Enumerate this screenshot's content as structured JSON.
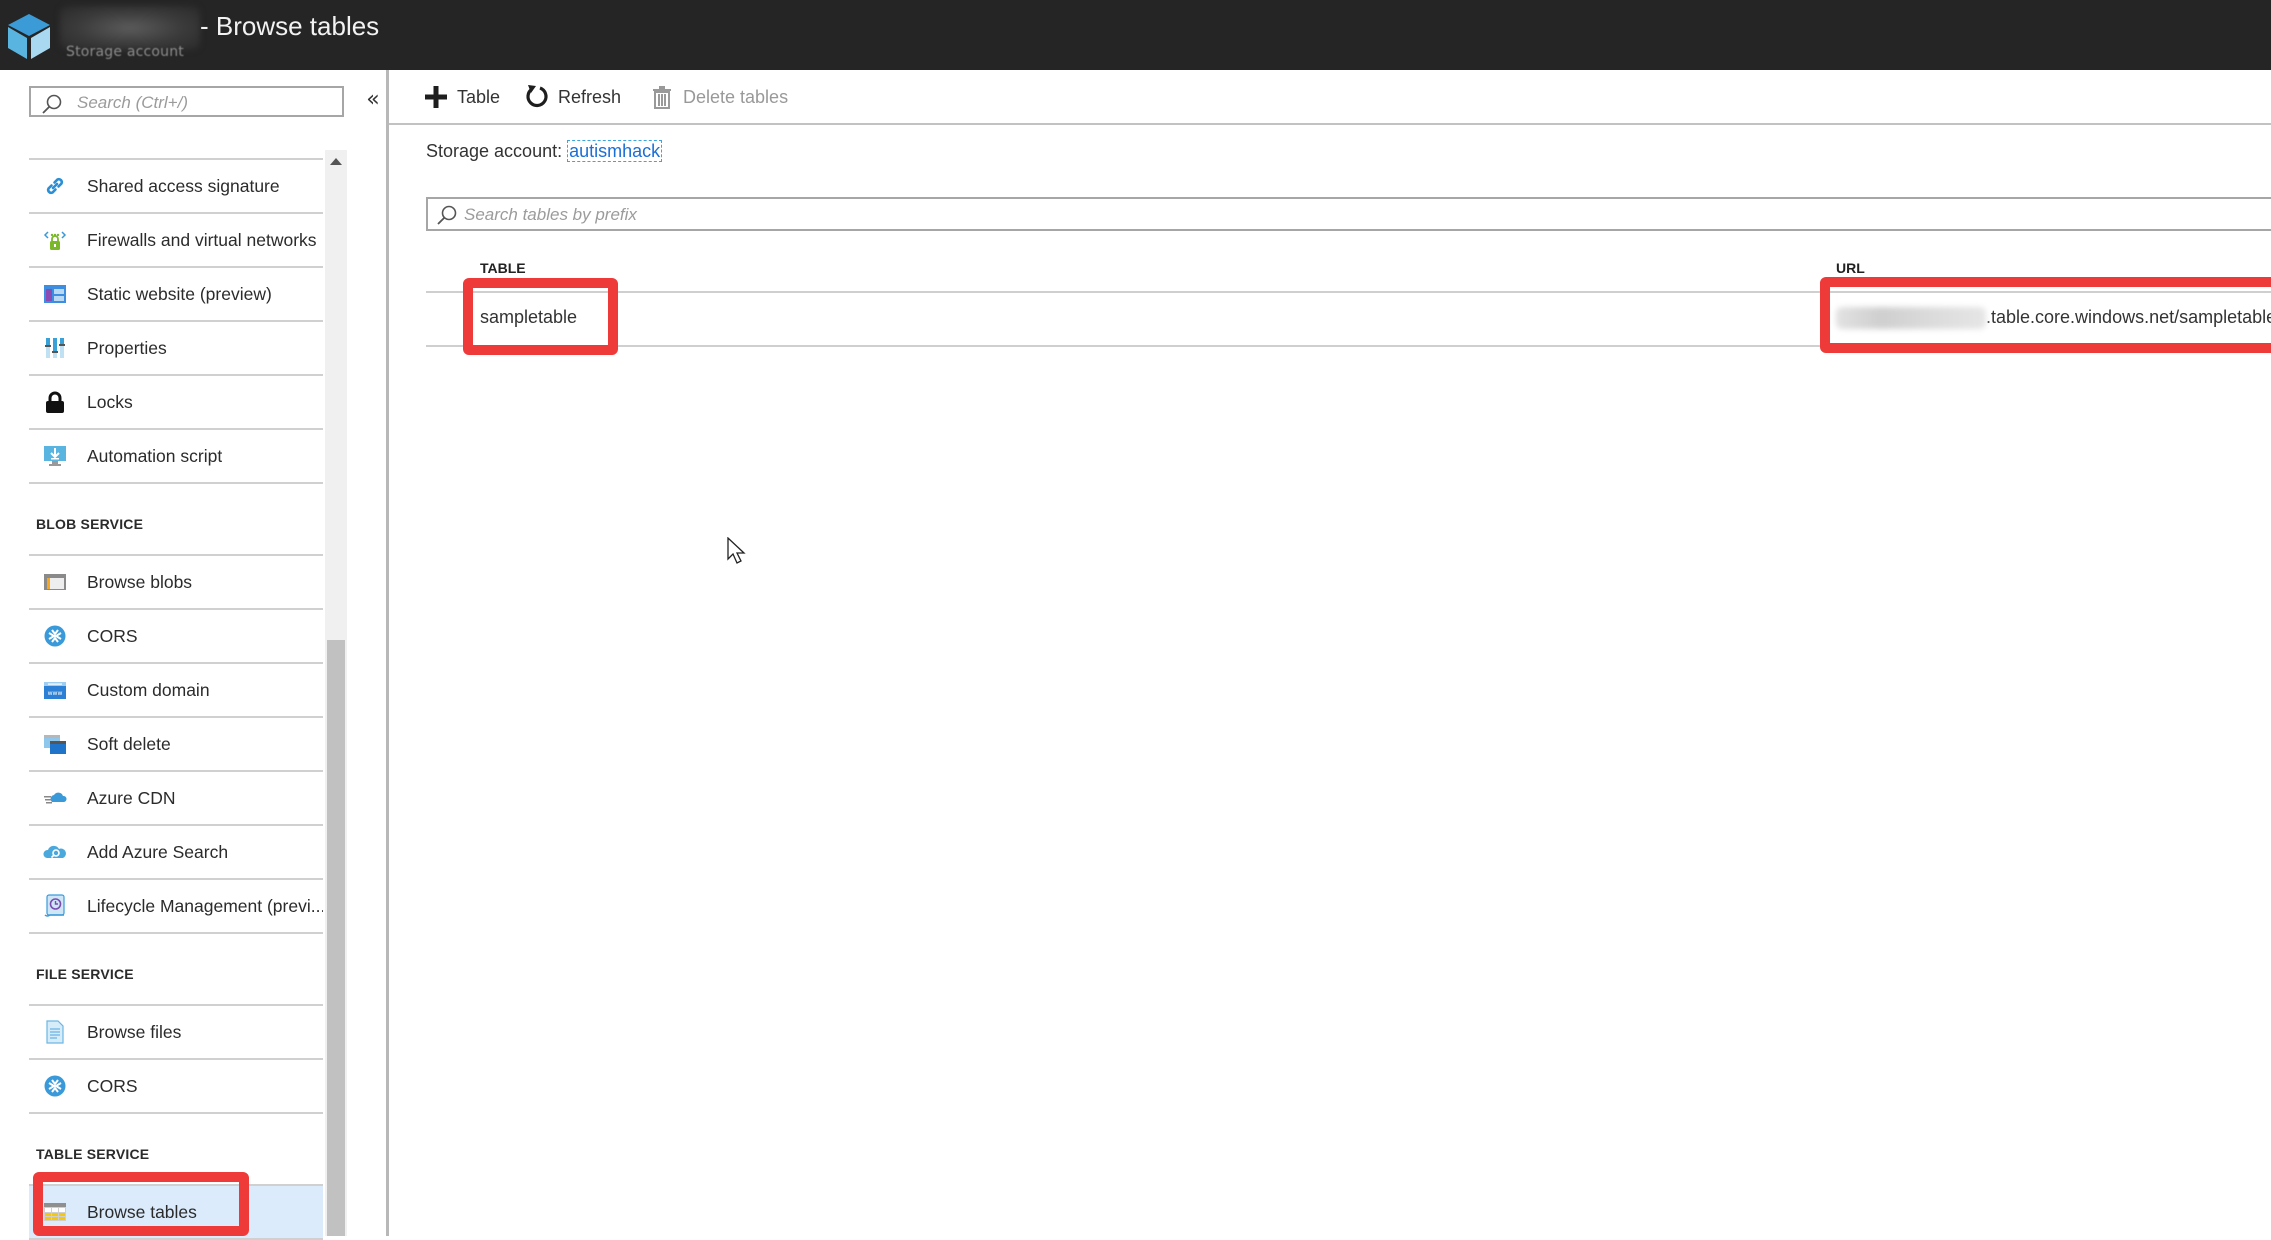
{
  "header": {
    "resource_name": "autismhack",
    "resource_type": "Storage account",
    "title": "- Browse tables",
    "logo_icon": "storage-cube-icon"
  },
  "sidebar": {
    "search_placeholder": "Search (Ctrl+/)",
    "collapse_label": "«",
    "sections": [
      {
        "heading": "",
        "items": [
          {
            "label": "Shared access signature",
            "icon": "link-icon"
          },
          {
            "label": "Firewalls and virtual networks",
            "icon": "firewall-icon"
          },
          {
            "label": "Static website (preview)",
            "icon": "static-website-icon"
          },
          {
            "label": "Properties",
            "icon": "properties-icon"
          },
          {
            "label": "Locks",
            "icon": "lock-icon"
          },
          {
            "label": "Automation script",
            "icon": "automation-script-icon"
          }
        ]
      },
      {
        "heading": "BLOB SERVICE",
        "items": [
          {
            "label": "Browse blobs",
            "icon": "browse-blobs-icon"
          },
          {
            "label": "CORS",
            "icon": "cors-icon"
          },
          {
            "label": "Custom domain",
            "icon": "custom-domain-icon"
          },
          {
            "label": "Soft delete",
            "icon": "soft-delete-icon"
          },
          {
            "label": "Azure CDN",
            "icon": "cdn-icon"
          },
          {
            "label": "Add Azure Search",
            "icon": "azure-search-icon"
          },
          {
            "label": "Lifecycle Management (previ...",
            "icon": "lifecycle-icon"
          }
        ]
      },
      {
        "heading": "FILE SERVICE",
        "items": [
          {
            "label": "Browse files",
            "icon": "browse-files-icon"
          },
          {
            "label": "CORS",
            "icon": "cors-icon"
          }
        ]
      },
      {
        "heading": "TABLE SERVICE",
        "items": [
          {
            "label": "Browse tables",
            "icon": "browse-tables-icon",
            "active": true
          }
        ]
      }
    ]
  },
  "toolbar": {
    "add_table_label": "Table",
    "refresh_label": "Refresh",
    "delete_label": "Delete tables"
  },
  "main": {
    "storage_account_label": "Storage account:",
    "storage_account_name": "autismhack",
    "search_placeholder": "Search tables by prefix",
    "columns": [
      "TABLE",
      "URL"
    ],
    "rows": [
      {
        "table": "sampletable",
        "url_visible": ".table.core.windows.net/sampletable",
        "url_prefix_redacted": true
      }
    ]
  },
  "colors": {
    "header_bg": "#252525",
    "accent_link": "#1a6fd6",
    "highlight_red": "#ef3a3a",
    "active_item_bg": "#dcebfb"
  }
}
